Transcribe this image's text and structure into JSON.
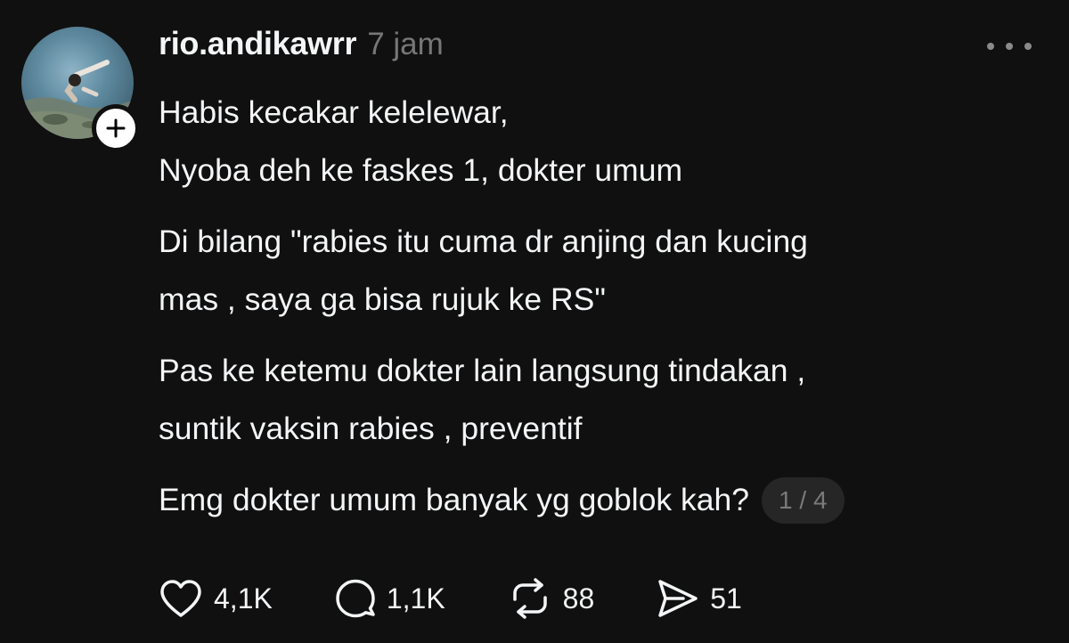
{
  "post": {
    "username": "rio.andikawrr",
    "time": "7 jam",
    "paragraphs": [
      [
        "Habis kecakar kelelewar,",
        "Nyoba deh ke faskes 1, dokter umum"
      ],
      [
        "Di bilang \"rabies itu cuma dr anjing dan kucing",
        "mas , saya ga bisa rujuk ke RS\""
      ],
      [
        "Pas ke ketemu dokter lain langsung tindakan ,",
        "suntik vaksin rabies , preventif"
      ],
      [
        "Emg dokter umum banyak yg goblok kah?"
      ]
    ],
    "page_indicator": "1 / 4"
  },
  "actions": {
    "likes": "4,1K",
    "comments": "1,1K",
    "reposts": "88",
    "shares": "51"
  },
  "icons": {
    "more": "more-horizontal-icon",
    "follow": "plus-icon",
    "like": "heart-icon",
    "comment": "comment-bubble-icon",
    "repost": "repost-icon",
    "share": "send-icon"
  },
  "colors": {
    "background": "#101010",
    "text": "#f3f5f7",
    "muted": "#777777",
    "pill": "#262626"
  }
}
